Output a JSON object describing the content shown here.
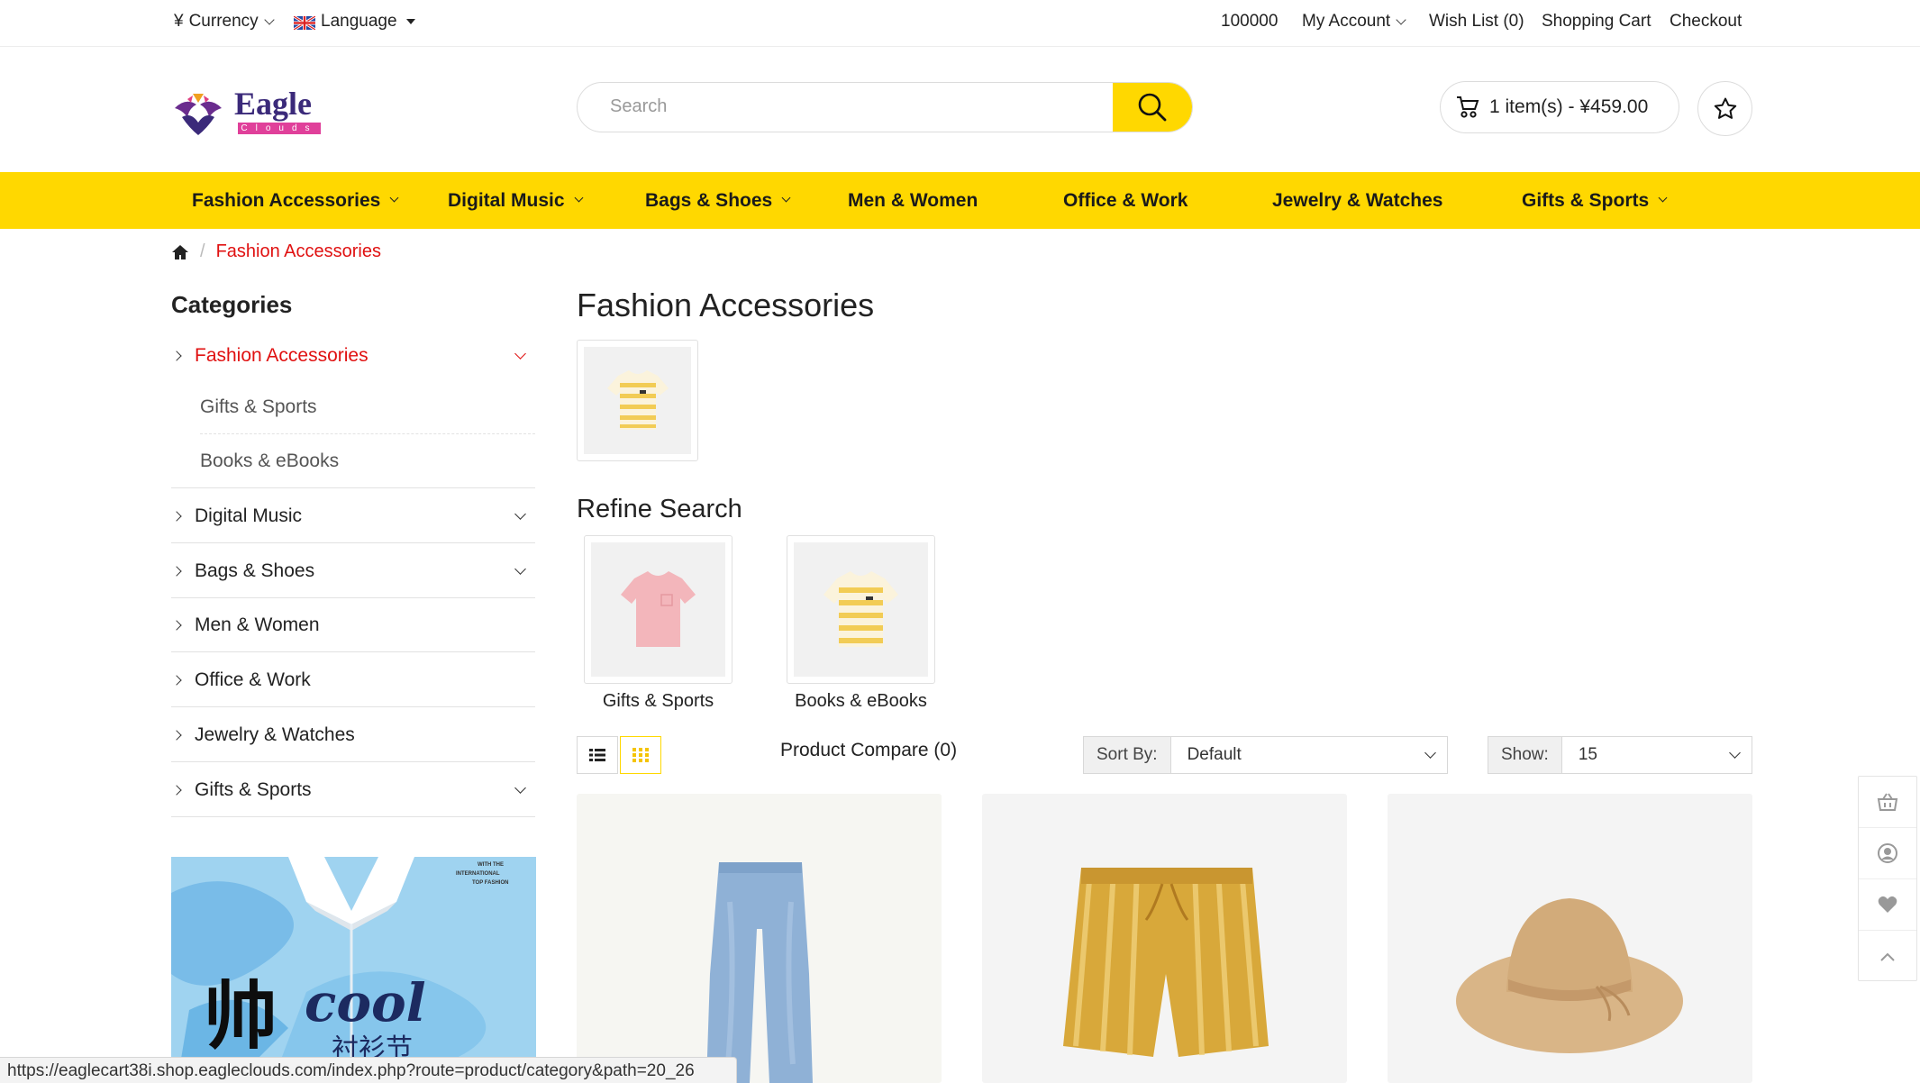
{
  "topbar": {
    "currency_symbol": "¥",
    "currency_label": "Currency",
    "language_label": "Language",
    "account_number": "100000",
    "my_account": "My Account",
    "wish_list": "Wish List (0)",
    "shopping_cart": "Shopping Cart",
    "checkout": "Checkout"
  },
  "logo": {
    "brand": "Eagle",
    "sub": "Clouds"
  },
  "search": {
    "placeholder": "Search"
  },
  "cart": {
    "summary": "1 item(s) - ¥459.00"
  },
  "nav": {
    "items": [
      {
        "label": "Fashion Accessories"
      },
      {
        "label": "Digital Music"
      },
      {
        "label": "Bags & Shoes"
      },
      {
        "label": "Men & Women"
      },
      {
        "label": "Office & Work"
      },
      {
        "label": "Jewelry & Watches"
      },
      {
        "label": "Gifts & Sports"
      }
    ]
  },
  "breadcrumb": {
    "current": "Fashion Accessories"
  },
  "sidebar": {
    "title": "Categories",
    "items": [
      {
        "label": "Fashion Accessories"
      },
      {
        "label": "Digital Music"
      },
      {
        "label": "Bags & Shoes"
      },
      {
        "label": "Men & Women"
      },
      {
        "label": "Office & Work"
      },
      {
        "label": "Jewelry & Watches"
      },
      {
        "label": "Gifts & Sports"
      }
    ],
    "subitems": [
      {
        "label": "Gifts & Sports"
      },
      {
        "label": "Books & eBooks"
      }
    ]
  },
  "banner": {
    "top_text_1": "WITH THE",
    "top_text_2": "INTERNATIONAL",
    "top_text_3": "TOP FASHION",
    "big_char": "帅",
    "script_word": "cool",
    "festival": "衬衫节"
  },
  "main": {
    "title": "Fashion Accessories",
    "refine_title": "Refine Search",
    "refine": [
      {
        "label": "Gifts & Sports"
      },
      {
        "label": "Books & eBooks"
      }
    ]
  },
  "toolbar": {
    "compare": "Product Compare (0)",
    "sort_label": "Sort By:",
    "sort_value": "Default",
    "show_label": "Show:",
    "show_value": "15"
  },
  "statusbar": {
    "url": "https://eaglecart38i.shop.eagleclouds.com/index.php?route=product/category&path=20_26"
  },
  "colors": {
    "accent": "#ffd800",
    "link_red": "#e01111",
    "text": "#222222"
  }
}
